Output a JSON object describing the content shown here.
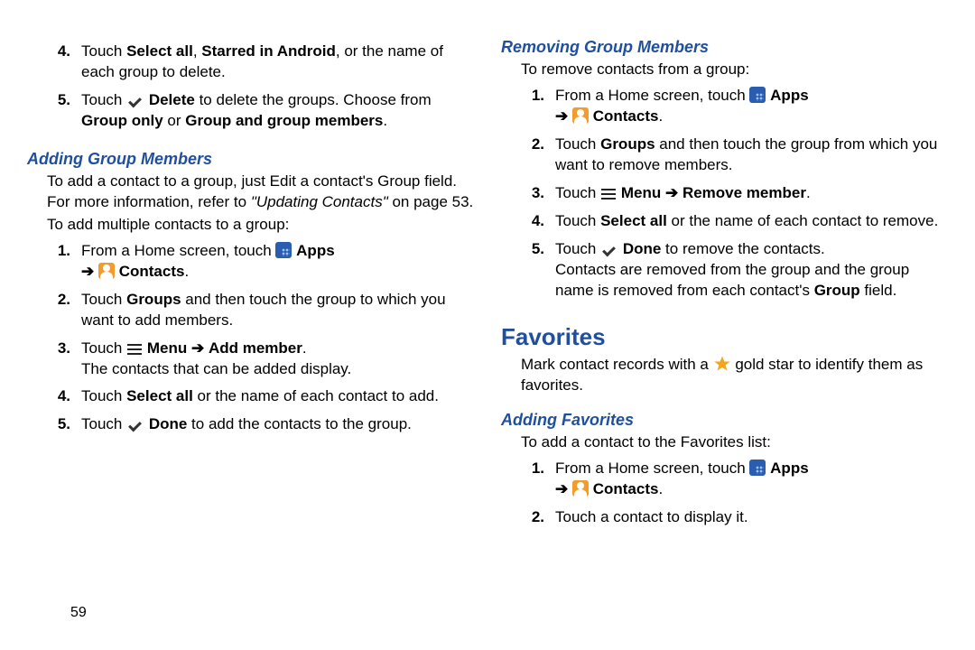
{
  "pageNumber": "59",
  "icons": {
    "apps": "apps-grid-icon",
    "contacts": "contacts-icon",
    "check": "check-icon",
    "menu": "menu-icon",
    "star": "gold-star-icon"
  },
  "labels": {
    "apps": "Apps",
    "contacts": "Contacts",
    "arrow": "➔",
    "menuArrow": "➔",
    "menu": "Menu",
    "delete": "Delete",
    "done": "Done",
    "selectAll": "Select all",
    "starredInAndroid": "Starred in Android",
    "groupOnly": "Group only",
    "groupAndMembers": "Group and group members",
    "groups": "Groups",
    "addMember": "Add member",
    "removeMember": "Remove member",
    "groupField": "Group"
  },
  "left": {
    "step4_a": "Touch ",
    "step4_b": ", ",
    "step4_c": ", or the name of each group to delete.",
    "step5_a": "Touch ",
    "step5_b": " to delete the groups. Choose from ",
    "step5_c": " or ",
    "step5_d": ".",
    "hAdding": "Adding Group Members",
    "p1_a": "To add a contact to a group, just Edit a contact's Group field. For more information, refer to ",
    "p1_ref": "\"Updating Contacts\"",
    "p1_b": " on page 53.",
    "p2": "To add multiple contacts to a group:",
    "a1_a": "From a Home screen, touch ",
    "a1_b": ".",
    "a2_a": "Touch ",
    "a2_b": " and then touch the group to which you want to add members.",
    "a3_a": "Touch ",
    "a3_b": ".",
    "a3_sub": "The contacts that can be added display.",
    "a4_a": "Touch ",
    "a4_b": " or the name of each contact to add.",
    "a5_a": "Touch ",
    "a5_b": " to add the contacts to the group."
  },
  "right": {
    "hRemoving": "Removing Group Members",
    "pRem": "To remove contacts from a group:",
    "r1_a": "From a Home screen, touch ",
    "r1_b": ".",
    "r2_a": "Touch ",
    "r2_b": " and then touch the group from which you want to remove members.",
    "r3_a": "Touch ",
    "r3_b": ".",
    "r4_a": "Touch ",
    "r4_b": " or the name of each contact to remove.",
    "r5_a": "Touch ",
    "r5_b": " to remove the contacts.",
    "r5_sub_a": "Contacts are removed from the group and the group name is removed from each contact's ",
    "r5_sub_b": " field.",
    "hFav": "Favorites",
    "fav_a": "Mark contact records with a ",
    "fav_b": " gold star to identify them as favorites.",
    "hAddFav": "Adding Favorites",
    "pAddFav": "To add a contact to the Favorites list:",
    "f1_a": "From a Home screen, touch ",
    "f1_b": ".",
    "f2": "Touch a contact to display it."
  }
}
